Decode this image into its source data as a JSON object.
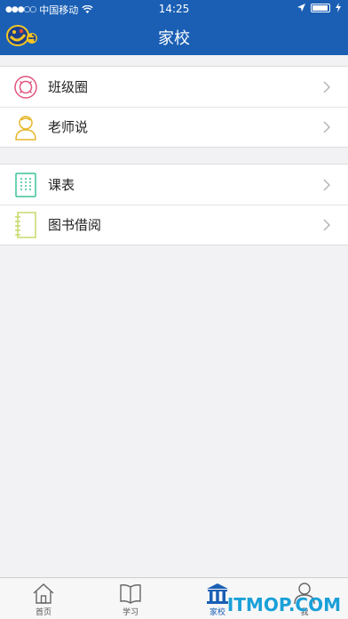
{
  "status": {
    "carrier": "中国移动",
    "time": "14:25"
  },
  "nav": {
    "title": "家校",
    "logo_icon": "app-logo-icon"
  },
  "groups": [
    {
      "items": [
        {
          "label": "班级圈",
          "icon": "class-circle-icon",
          "color": "#e0567e"
        },
        {
          "label": "老师说",
          "icon": "teacher-icon",
          "color": "#e8b62a"
        }
      ]
    },
    {
      "items": [
        {
          "label": "课表",
          "icon": "schedule-icon",
          "color": "#3cc29a"
        },
        {
          "label": "图书借阅",
          "icon": "notebook-icon",
          "color": "#c8d86a"
        }
      ]
    }
  ],
  "tabs": [
    {
      "label": "首页",
      "icon": "home-icon",
      "active": false
    },
    {
      "label": "学习",
      "icon": "book-icon",
      "active": false
    },
    {
      "label": "家校",
      "icon": "school-icon",
      "active": true
    },
    {
      "label": "我",
      "icon": "user-icon",
      "active": false
    }
  ],
  "watermark": "ITMOP.COM",
  "colors": {
    "primary": "#1a5fb4",
    "chevron": "#b5b5b8"
  }
}
